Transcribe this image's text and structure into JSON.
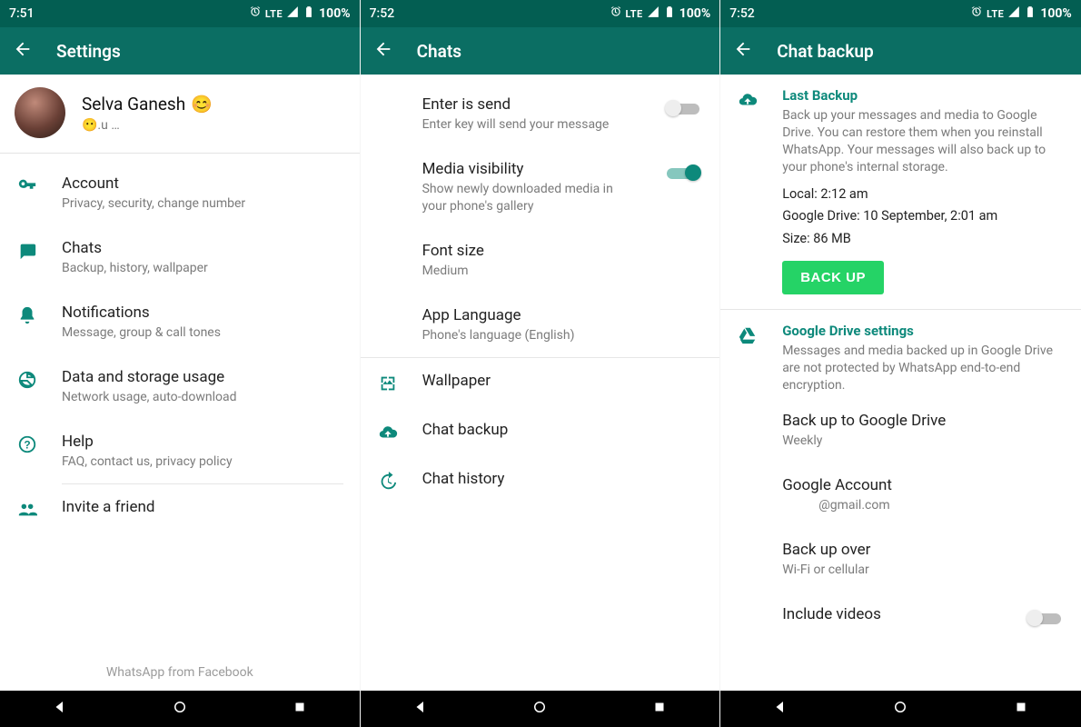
{
  "status": {
    "lte": "LTE",
    "battery": "100%"
  },
  "screens": [
    {
      "time": "7:51",
      "title": "Settings",
      "profile": {
        "name": "Selva Ganesh",
        "emoji": "😊",
        "status_hint": "😶.u   …"
      },
      "items": [
        {
          "icon": "key",
          "label": "Account",
          "sub": "Privacy, security, change number"
        },
        {
          "icon": "chat",
          "label": "Chats",
          "sub": "Backup, history, wallpaper"
        },
        {
          "icon": "bell",
          "label": "Notifications",
          "sub": "Message, group & call tones"
        },
        {
          "icon": "data",
          "label": "Data and storage usage",
          "sub": "Network usage, auto-download"
        },
        {
          "icon": "help",
          "label": "Help",
          "sub": "FAQ, contact us, privacy policy"
        },
        {
          "icon": "people",
          "label": "Invite a friend",
          "sub": ""
        }
      ],
      "footer": "WhatsApp from Facebook"
    },
    {
      "time": "7:52",
      "title": "Chats",
      "toggles": [
        {
          "label": "Enter is send",
          "sub": "Enter key will send your message",
          "on": false
        },
        {
          "label": "Media visibility",
          "sub": "Show newly downloaded media in your phone's gallery",
          "on": true
        }
      ],
      "simple": [
        {
          "label": "Font size",
          "sub": "Medium"
        },
        {
          "label": "App Language",
          "sub": "Phone's language (English)"
        }
      ],
      "iconed": [
        {
          "icon": "wallpaper",
          "label": "Wallpaper"
        },
        {
          "icon": "cloud-up",
          "label": "Chat backup"
        },
        {
          "icon": "history",
          "label": "Chat history"
        }
      ]
    },
    {
      "time": "7:52",
      "title": "Chat backup",
      "last_backup": {
        "header": "Last Backup",
        "desc": "Back up your messages and media to Google Drive. You can restore them when you reinstall WhatsApp. Your messages will also back up to your phone's internal storage.",
        "local": "Local: 2:12 am",
        "drive": "Google Drive: 10 September, 2:01 am",
        "size": "Size: 86 MB",
        "btn": "BACK UP"
      },
      "gdrive": {
        "header": "Google Drive settings",
        "desc": "Messages and media backed up in Google Drive are not protected by WhatsApp end-to-end encryption.",
        "items": [
          {
            "label": "Back up to Google Drive",
            "sub": "Weekly"
          },
          {
            "label": "Google Account",
            "sub": "@gmail.com"
          },
          {
            "label": "Back up over",
            "sub": "Wi-Fi or cellular"
          }
        ],
        "include_videos": {
          "label": "Include videos",
          "on": false
        }
      }
    }
  ]
}
